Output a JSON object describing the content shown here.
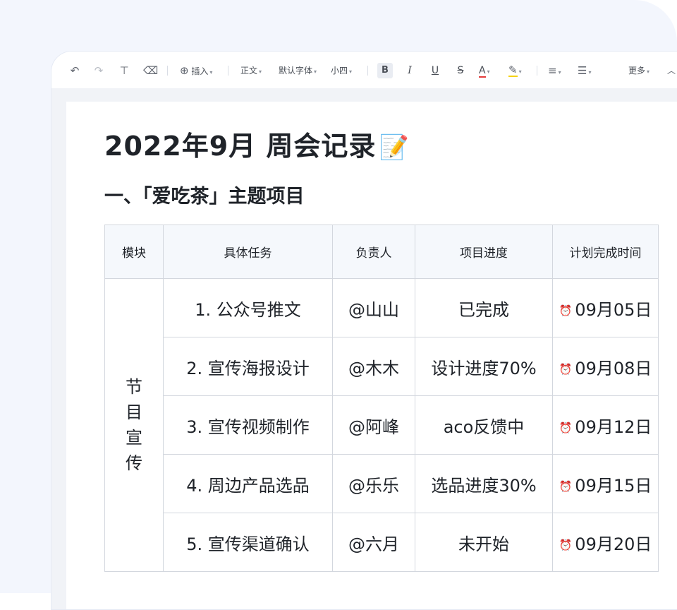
{
  "toolbar": {
    "insert_label": "插入",
    "style_label": "正文",
    "font_label": "默认字体",
    "size_label": "小四",
    "bold_label": "B",
    "italic_label": "I",
    "underline_label": "U",
    "strike_label": "S",
    "font_color_label": "A",
    "more_label": "更多",
    "icons": [
      "undo-icon",
      "redo-icon",
      "format-painter-icon",
      "eraser-icon",
      "plus-circle-icon",
      "highlighter-icon",
      "align-icon",
      "list-icon",
      "collapse-icon"
    ],
    "font_color": "#e23b3b",
    "highlight_color": "#f5d214"
  },
  "document": {
    "title": "2022年9月 周会记录",
    "title_icon": "📝",
    "section_heading": "一、「爱吃茶」主题项目",
    "table": {
      "headers": [
        "模块",
        "具体任务",
        "负责人",
        "项目进度",
        "计划完成时间"
      ],
      "module_chars": [
        "节",
        "目",
        "宣",
        "传"
      ],
      "rows": [
        {
          "task": "1. 公众号推文",
          "owner": "@山山",
          "progress": "已完成",
          "due": "09月05日",
          "due_status": "done"
        },
        {
          "task": "2. 宣传海报设计",
          "owner": "@木木",
          "progress": "设计进度70%",
          "due": "09月08日",
          "due_status": "pending"
        },
        {
          "task": "3. 宣传视频制作",
          "owner": "@阿峰",
          "progress": "aco反馈中",
          "due": "09月12日",
          "due_status": "pending"
        },
        {
          "task": "4. 周边产品选品",
          "owner": "@乐乐",
          "progress": "选品进度30%",
          "due": "09月15日",
          "due_status": "pending"
        },
        {
          "task": "5. 宣传渠道确认",
          "owner": "@六月",
          "progress": "未开始",
          "due": "09月20日",
          "due_status": "pending"
        }
      ]
    }
  },
  "colors": {
    "mention": "#3d8df5",
    "due_done": "#8a8f99",
    "due_pending": "#f5871f"
  }
}
